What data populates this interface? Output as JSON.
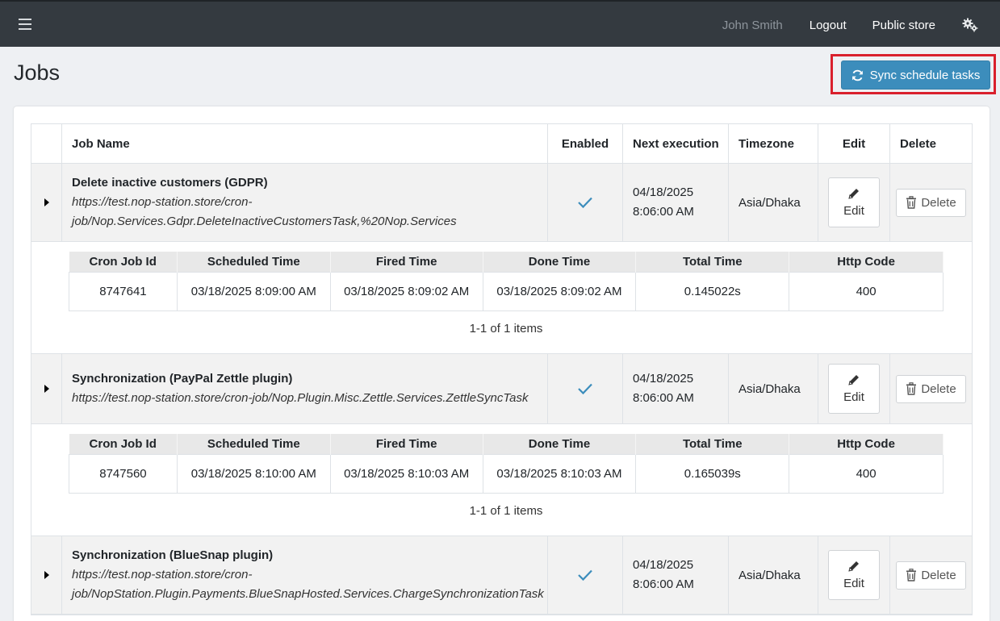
{
  "topbar": {
    "user_name": "John Smith",
    "logout": "Logout",
    "public_store": "Public store"
  },
  "page": {
    "title": "Jobs"
  },
  "sync_button": {
    "label": "Sync schedule tasks"
  },
  "grid": {
    "headers": [
      "Job Name",
      "Enabled",
      "Next execution",
      "Timezone",
      "Edit",
      "Delete"
    ],
    "sub_headers": [
      "Cron Job Id",
      "Scheduled Time",
      "Fired Time",
      "Done Time",
      "Total Time",
      "Http Code"
    ],
    "jobs": [
      {
        "name": "Delete inactive customers (GDPR)",
        "url_line1": "https://test.nop-station.store/cron-",
        "url_line2": "job/Nop.Services.Gdpr.DeleteInactiveCustomersTask,%20Nop.Services",
        "next_date": "04/18/2025",
        "next_time": "8:06:00 AM",
        "timezone": "Asia/Dhaka",
        "edit": "Edit",
        "delete": "Delete",
        "runs": [
          {
            "id": "8747641",
            "scheduled": "03/18/2025 8:09:00 AM",
            "fired": "03/18/2025 8:09:02 AM",
            "done": "03/18/2025 8:09:02 AM",
            "total": "0.145022s",
            "http": "400"
          }
        ],
        "pager": "1-1 of 1 items"
      },
      {
        "name": "Synchronization (PayPal Zettle plugin)",
        "url_line1": "https://test.nop-station.store/cron-job/Nop.Plugin.Misc.Zettle.Services.ZettleSyncTask",
        "url_line2": "",
        "next_date": "04/18/2025",
        "next_time": "8:06:00 AM",
        "timezone": "Asia/Dhaka",
        "edit": "Edit",
        "delete": "Delete",
        "runs": [
          {
            "id": "8747560",
            "scheduled": "03/18/2025 8:10:00 AM",
            "fired": "03/18/2025 8:10:03 AM",
            "done": "03/18/2025 8:10:03 AM",
            "total": "0.165039s",
            "http": "400"
          }
        ],
        "pager": "1-1 of 1 items"
      },
      {
        "name": "Synchronization (BlueSnap plugin)",
        "url_line1": "https://test.nop-station.store/cron-",
        "url_line2": "job/NopStation.Plugin.Payments.BlueSnapHosted.Services.ChargeSynchronizationTask",
        "next_date": "04/18/2025",
        "next_time": "8:06:00 AM",
        "timezone": "Asia/Dhaka",
        "edit": "Edit",
        "delete": "Delete"
      }
    ]
  },
  "colors": {
    "topbar": "#343a40",
    "primary_button": "#3c8dbc",
    "highlight_border": "#d9202c",
    "check": "#3c8dbc"
  }
}
